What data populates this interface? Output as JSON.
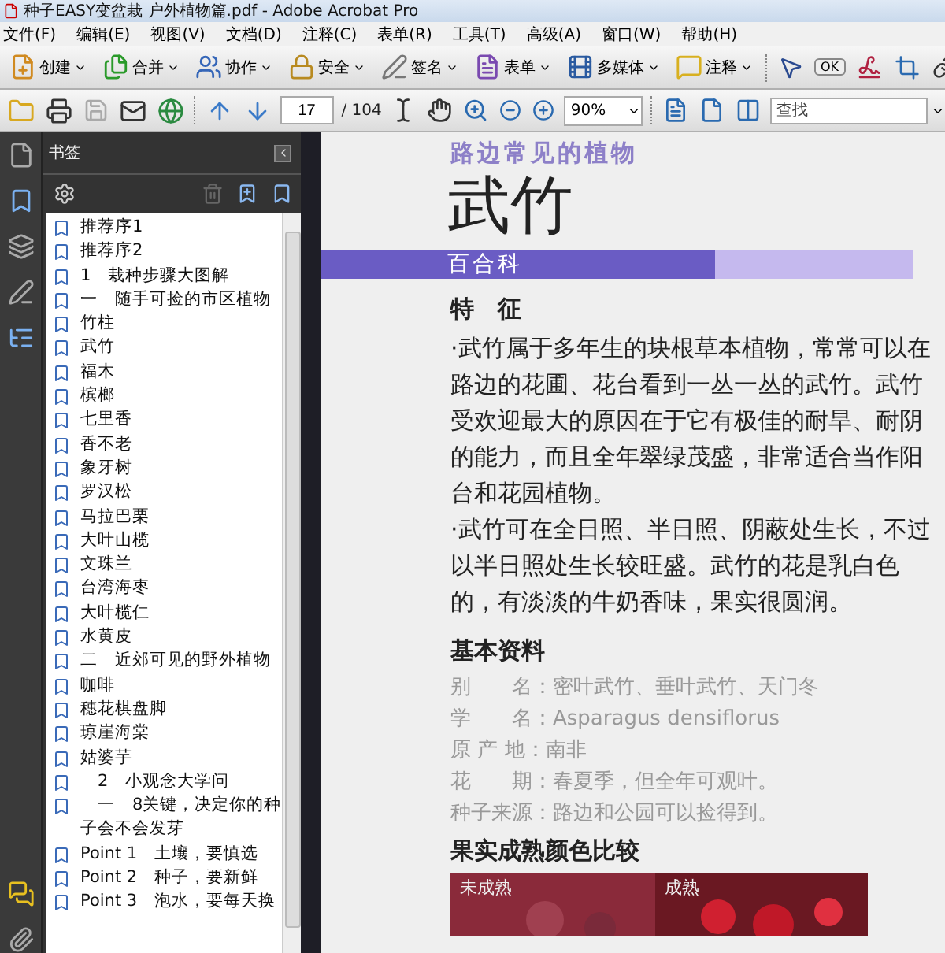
{
  "window": {
    "title": "种子EASY变盆栽 户外植物篇.pdf - Adobe Acrobat Pro"
  },
  "menu": [
    "文件(F)",
    "编辑(E)",
    "视图(V)",
    "文档(D)",
    "注释(C)",
    "表单(R)",
    "工具(T)",
    "高级(A)",
    "窗口(W)",
    "帮助(H)"
  ],
  "task_toolbar": [
    {
      "kind": "create",
      "label": "创建"
    },
    {
      "kind": "combine",
      "label": "合并"
    },
    {
      "kind": "collaborate",
      "label": "协作"
    },
    {
      "kind": "secure",
      "label": "安全"
    },
    {
      "kind": "sign",
      "label": "签名"
    },
    {
      "kind": "forms",
      "label": "表单"
    },
    {
      "kind": "multimedia",
      "label": "多媒体"
    },
    {
      "kind": "comment",
      "label": "注释"
    }
  ],
  "form_button_icon": "OK",
  "nav_toolbar": {
    "page": "17",
    "page_count": "/ 104",
    "zoom": "90%",
    "search_placeholder": "查找"
  },
  "bookmarks": {
    "title": "书签",
    "items": [
      "推荐序1",
      "推荐序2",
      "1　栽种步骤大图解",
      "一　随手可捡的市区植物",
      "竹柱",
      "武竹",
      "福木",
      "槟榔",
      "七里香",
      "香不老",
      "象牙树",
      "罗汉松",
      "马拉巴栗",
      "大叶山榄",
      "文珠兰",
      "台湾海枣",
      "大叶榄仁",
      "水黄皮",
      "二　近郊可见的野外植物",
      "咖啡",
      "穗花棋盘脚",
      "琼崖海棠",
      "姑婆芋",
      "　2　小观念大学问",
      "　一　8关键，决定你的种子会不会发芽",
      "Point 1　土壤，要慎选",
      "Point 2　种子，要新鲜",
      "Point 3　泡水，要每天换"
    ]
  },
  "document": {
    "kicker": "路边常见的植物",
    "title": "武竹",
    "family": "百合科",
    "features_heading": "特　征",
    "paragraphs": [
      "·武竹属于多年生的块根草本植物，常常可以在路边的花圃、花台看到一丛一丛的武竹。武竹受欢迎最大的原因在于它有极佳的耐旱、耐阴的能力，而且全年翠绿茂盛，非常适合当作阳台和花园植物。",
      "·武竹可在全日照、半日照、阴蔽处生长，不过以半日照处生长较旺盛。武竹的花是乳白色的，有淡淡的牛奶香味，果实很圆润。"
    ],
    "info_heading": "基本资料",
    "info": [
      {
        "label": "别　　名：",
        "value": "密叶武竹、垂叶武竹、天门冬"
      },
      {
        "label": "学　　名：",
        "value": "Asparagus densiflorus"
      },
      {
        "label": "原 产 地：",
        "value": "南非"
      },
      {
        "label": "花　　期：",
        "value": "春夏季，但全年可观叶。"
      },
      {
        "label": "种子来源：",
        "value": "路边和公园可以捡得到。"
      }
    ],
    "fruit_heading": "果实成熟颜色比较",
    "photo_captions": [
      "未成熟",
      "成熟"
    ]
  }
}
